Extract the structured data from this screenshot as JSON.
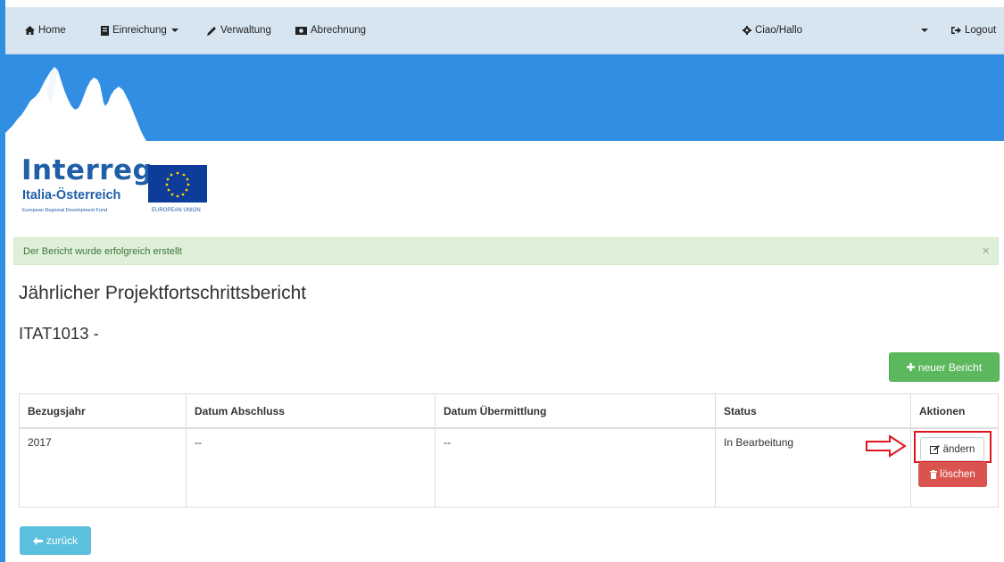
{
  "nav": {
    "home": "Home",
    "submission": "Einreichung",
    "administration": "Verwaltung",
    "billing": "Abrechnung",
    "user": "Ciao/Hallo",
    "logout": "Logout"
  },
  "logo": {
    "title": "Interreg",
    "subtitle": "Italia-Österreich",
    "fund": "European Regional Development Fund",
    "eu": "EUROPEAN UNION"
  },
  "alert": {
    "message": "Der Bericht wurde erfolgreich erstellt",
    "close": "×"
  },
  "page": {
    "title": "Jährlicher Projektfortschrittsbericht",
    "project_code": "ITAT1013 -",
    "new_report_label": "neuer Bericht",
    "back_label": "zurück"
  },
  "table": {
    "headers": [
      "Bezugsjahr",
      "Datum Abschluss",
      "Datum Übermittlung",
      "Status",
      "Aktionen"
    ],
    "rows": [
      {
        "year": "2017",
        "closing_date": "--",
        "transmission_date": "--",
        "status": "In Bearbeitung",
        "edit_label": "ändern",
        "delete_label": "löschen"
      }
    ]
  },
  "colors": {
    "banner": "#318ee3",
    "navbar": "#d7e5f0",
    "success": "#5cb85c",
    "danger": "#d9534f",
    "info": "#5bc0de",
    "annotation": "#e0141c"
  }
}
